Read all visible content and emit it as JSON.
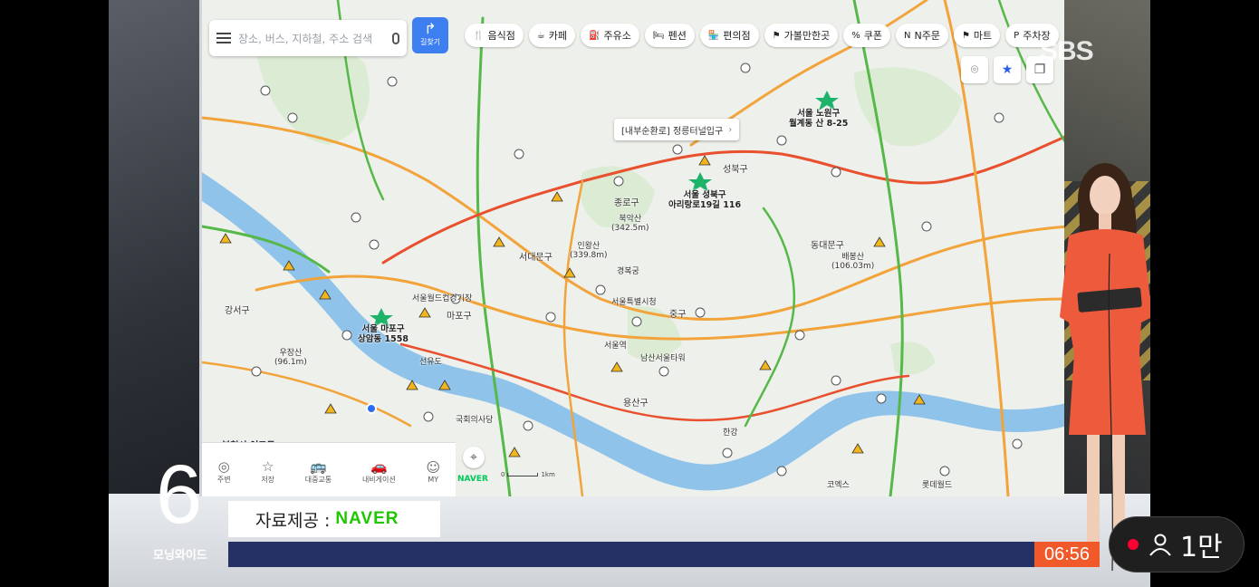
{
  "map": {
    "search_placeholder": "장소, 버스, 지하철, 주소 검색",
    "directions_label": "길찾기",
    "categories": [
      {
        "icon": "🍴",
        "label": "음식점"
      },
      {
        "icon": "☕",
        "label": "카페"
      },
      {
        "icon": "⛽",
        "label": "주유소"
      },
      {
        "icon": "🛏",
        "label": "펜션"
      },
      {
        "icon": "🏪",
        "label": "편의점"
      },
      {
        "icon": "⚑",
        "label": "가볼만한곳"
      },
      {
        "icon": "%",
        "label": "쿠폰"
      },
      {
        "icon": "N",
        "label": "N주문"
      },
      {
        "icon": "⚑",
        "label": "마트"
      },
      {
        "icon": "P",
        "label": "주차장"
      }
    ],
    "callout": "[내부순환로] 정릉터널입구",
    "places": {
      "nowon": "서울 노원구\n월계동 산 8-25",
      "seongbuk": "서울 성북구\n아리랑로19길 116",
      "mapo": "서울 마포구\n상암동 1558",
      "bugaksan": "북악산\n(342.5m)",
      "inwangsan": "인왕산\n(339.8m)",
      "ujangsan": "우장산\n(96.1m)",
      "baebongsan": "배봉산\n(106.03m)",
      "gangseo": "강서구",
      "mapogu": "마포구",
      "seodaemun": "서대문구",
      "jongno": "종로구",
      "junggu": "중구",
      "yongsan": "용산구",
      "dongdaemun": "동대문구",
      "seongbukgu": "성북구",
      "gyeongbokgung": "경복궁",
      "seoulstation": "서울역",
      "namsan": "남산서울타워",
      "seoulcityhall": "서울특별시청",
      "seonyudo": "선유도",
      "yeouido": "국회의사당",
      "lotteworld": "롯데월드",
      "coex": "코엑스",
      "hangang": "한강",
      "bucheon": "부천시 여고도",
      "hanyang": "서울월드컵경기장"
    },
    "bottom_nav": [
      {
        "icon": "◎",
        "label": "주변"
      },
      {
        "icon": "☆",
        "label": "저장"
      },
      {
        "icon": "🚌",
        "label": "대중교통"
      },
      {
        "icon": "🚗",
        "label": "내비게이션"
      },
      {
        "icon": "☺",
        "label": "MY"
      }
    ],
    "brand": "NAVER",
    "scale_left": "0",
    "scale_right": "1km",
    "bottom_title": "부천시 여고도"
  },
  "broadcast": {
    "channel_logo": "SBS",
    "show_number": "6",
    "show_name": "모닝와이드",
    "credit_prefix": "자료제공 :",
    "credit_brand": "NAVER",
    "clock": "06:56"
  },
  "overlay": {
    "live_dot_color": "#ff0033",
    "viewer_count": "1만"
  },
  "colors": {
    "road_congested": "#e8502e",
    "road_slow": "#f2a33a",
    "road_smooth": "#56b848",
    "river": "#8fc3ea",
    "accent_blue": "#3d7ff1",
    "naver_green": "#1ec800"
  }
}
